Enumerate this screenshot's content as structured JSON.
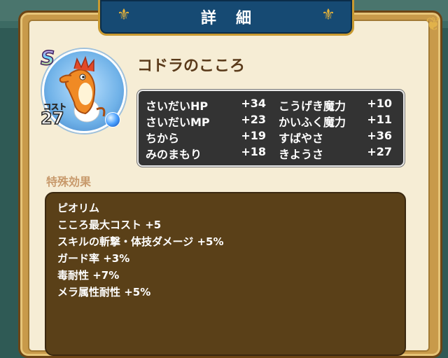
{
  "header": {
    "title": "詳細"
  },
  "monster": {
    "name": "コドラのこころ",
    "rank": "S",
    "cost_label": "コスト",
    "cost": "27"
  },
  "stats": [
    {
      "label": "さいだいHP",
      "value": "+34",
      "label2": "こうげき魔力",
      "value2": "+10"
    },
    {
      "label": "さいだいMP",
      "value": "+23",
      "label2": "かいふく魔力",
      "value2": "+11"
    },
    {
      "label": "ちから",
      "value": "+19",
      "label2": "すばやさ",
      "value2": "+36"
    },
    {
      "label": "みのまもり",
      "value": "+18",
      "label2": "きようさ",
      "value2": "+27"
    }
  ],
  "special_effects": {
    "title": "特殊効果",
    "items": [
      "ピオリム",
      "こころ最大コスト +5",
      "スキルの斬撃・体技ダメージ +5%",
      "ガード率 +3%",
      "毒耐性 +7%",
      "メラ属性耐性 +5%"
    ]
  },
  "colors": {
    "banner": "#164a73",
    "panel_bg": "#f6edd5",
    "stats_bg": "#333333",
    "effects_bg": "#5a4018"
  }
}
